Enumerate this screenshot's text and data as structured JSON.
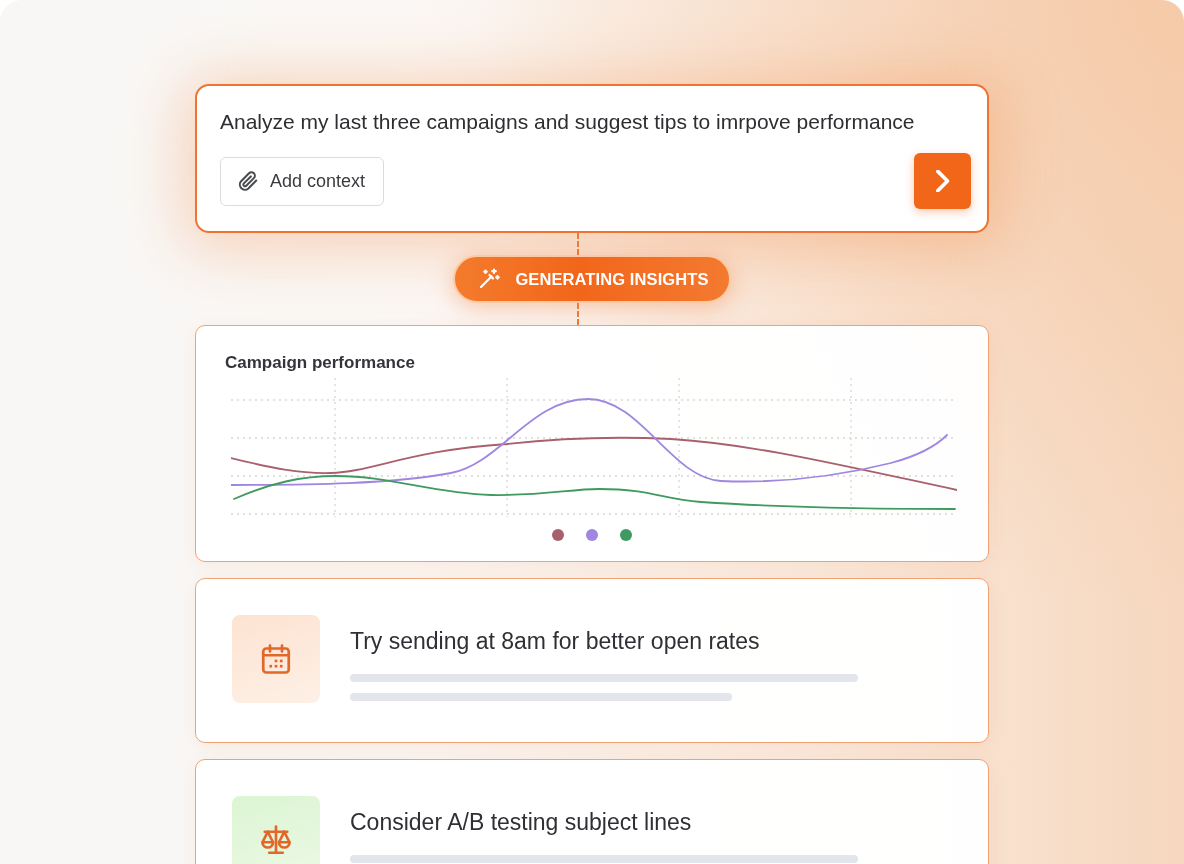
{
  "prompt": {
    "value": "Analyze my last three campaigns and suggest tips to imrpove performance",
    "context_button": "Add context"
  },
  "status": {
    "label": "GENERATING INSIGHTS"
  },
  "chart_card": {
    "title": "Campaign performance",
    "legend": [
      {
        "color": "#a8606e"
      },
      {
        "color": "#9f86e0"
      },
      {
        "color": "#3f9a5f"
      }
    ]
  },
  "tips": [
    {
      "kind": "calendar",
      "text": "Try sending at 8am for better open rates"
    },
    {
      "kind": "scale",
      "text": "Consider A/B testing subject lines"
    }
  ]
}
